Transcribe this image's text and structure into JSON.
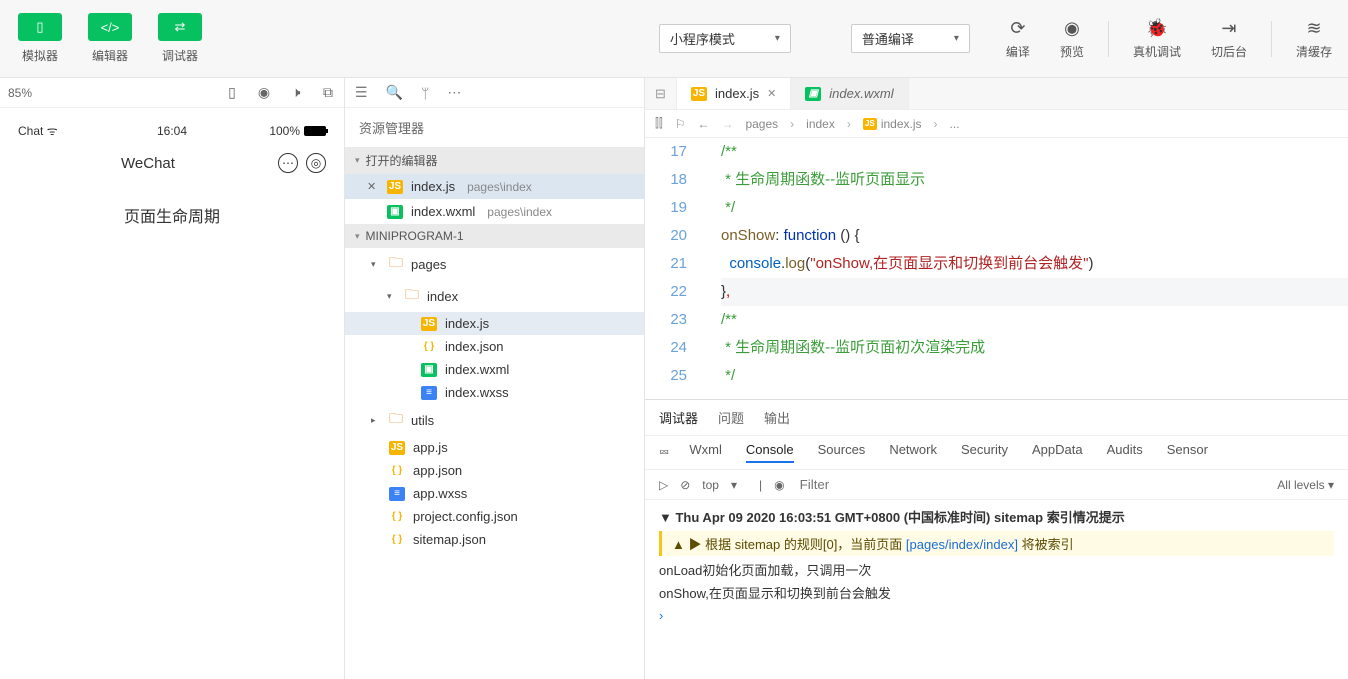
{
  "toolbar": {
    "simulator": "模拟器",
    "editor": "编辑器",
    "debugger": "调试器",
    "mode": "小程序模式",
    "compile": "普通编译",
    "compile_btn": "编译",
    "preview": "预览",
    "remote": "真机调试",
    "background": "切后台",
    "clear": "清缓存"
  },
  "simbar": {
    "zoom": "85%"
  },
  "phone": {
    "carrier": "Chat",
    "time": "16:04",
    "battery": "100%",
    "app": "WeChat",
    "page_title": "页面生命周期"
  },
  "explorer": {
    "title": "资源管理器",
    "open_editors": "打开的编辑器",
    "project": "MINIPROGRAM-1",
    "open": [
      {
        "name": "index.js",
        "path": "pages\\index",
        "iconClass": "js",
        "iconText": "JS",
        "active": true
      },
      {
        "name": "index.wxml",
        "path": "pages\\index",
        "iconClass": "wxml",
        "iconText": "▣",
        "active": false
      }
    ],
    "tree": {
      "pages": "pages",
      "index": "index",
      "files_index": [
        {
          "name": "index.js",
          "icon": "js",
          "t": "JS",
          "sel": true
        },
        {
          "name": "index.json",
          "icon": "json",
          "t": "{ }"
        },
        {
          "name": "index.wxml",
          "icon": "wxml",
          "t": "▣"
        },
        {
          "name": "index.wxss",
          "icon": "wxss",
          "t": "≡"
        }
      ],
      "utils": "utils",
      "root": [
        {
          "name": "app.js",
          "icon": "js",
          "t": "JS"
        },
        {
          "name": "app.json",
          "icon": "json",
          "t": "{ }"
        },
        {
          "name": "app.wxss",
          "icon": "wxss",
          "t": "≡"
        },
        {
          "name": "project.config.json",
          "icon": "json",
          "t": "{ }"
        },
        {
          "name": "sitemap.json",
          "icon": "json",
          "t": "{ }"
        }
      ]
    }
  },
  "tabs": {
    "active": "index.js",
    "inactive": "index.wxml"
  },
  "breadcrumb": [
    "pages",
    "index",
    "index.js",
    "..."
  ],
  "code": {
    "start": 17,
    "lines": [
      {
        "n": 17,
        "html": "<span class='c-green'>/**</span>"
      },
      {
        "n": 18,
        "html": "<span class='c-green'> * 生命周期函数--监听页面显示</span>"
      },
      {
        "n": 19,
        "html": "<span class='c-green'> */</span>"
      },
      {
        "n": 20,
        "html": "<span class='c-func'>onShow</span><span class='c-punc'>:</span> <span class='c-kw'>function</span> <span class='c-punc'>() {</span>"
      },
      {
        "n": 21,
        "html": "  <span class='c-blue'>console</span><span class='c-punc'>.</span><span class='c-func'>log</span><span class='c-punc'>(</span><span class='c-str'>\"onShow,在页面显示和切换到前台会触发\"</span><span class='c-punc'>)</span>"
      },
      {
        "n": 22,
        "html": "<span class='c-punc'>}</span><span class='c-comma'>,</span>",
        "hl": true
      },
      {
        "n": 23,
        "html": "<span class='c-green'>/**</span>"
      },
      {
        "n": 24,
        "html": "<span class='c-green'> * 生命周期函数--监听页面初次渲染完成</span>"
      },
      {
        "n": 25,
        "html": "<span class='c-green'> */</span>"
      }
    ]
  },
  "debug": {
    "tabs": [
      "调试器",
      "问题",
      "输出"
    ],
    "devtabs": [
      "Wxml",
      "Console",
      "Sources",
      "Network",
      "Security",
      "AppData",
      "Audits",
      "Sensor"
    ],
    "active_devtab": "Console",
    "context": "top",
    "filter_ph": "Filter",
    "levels": "All levels",
    "head": "Thu Apr 09 2020 16:03:51 GMT+0800 (中国标准时间) sitemap 索引情况提示",
    "warn_pre": "▶ 根据 sitemap 的规则[0]，当前页面 ",
    "warn_link": "[pages/index/index]",
    "warn_post": " 将被索引",
    "log1": "onLoad初始化页面加载，只调用一次",
    "log2": "onShow,在页面显示和切换到前台会触发"
  }
}
